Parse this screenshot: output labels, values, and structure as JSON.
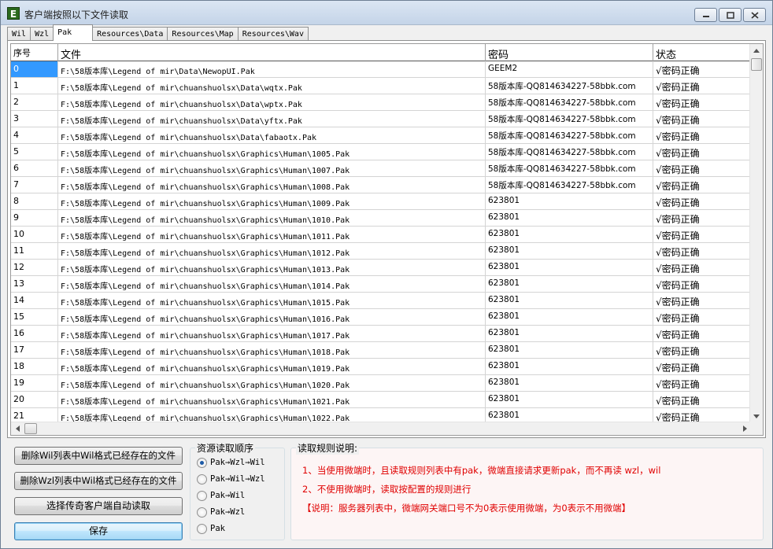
{
  "window": {
    "icon_letter": "E",
    "title": "客户端按照以下文件读取"
  },
  "tabs": [
    "Wil",
    "Wzl",
    "Pak",
    "Resources\\Data",
    "Resources\\Map",
    "Resources\\Wav"
  ],
  "active_tab": "Pak",
  "table": {
    "headers": [
      "序号",
      "文件",
      "密码",
      "状态"
    ],
    "rows": [
      [
        "0",
        "F:\\58版本库\\Legend of mir\\Data\\NewopUI.Pak",
        "GEEM2",
        "√密码正确"
      ],
      [
        "1",
        "F:\\58版本库\\Legend of mir\\chuanshuolsx\\Data\\wqtx.Pak",
        "58版本库-QQ814634227-58bbk.com",
        "√密码正确"
      ],
      [
        "2",
        "F:\\58版本库\\Legend of mir\\chuanshuolsx\\Data\\wptx.Pak",
        "58版本库-QQ814634227-58bbk.com",
        "√密码正确"
      ],
      [
        "3",
        "F:\\58版本库\\Legend of mir\\chuanshuolsx\\Data\\yftx.Pak",
        "58版本库-QQ814634227-58bbk.com",
        "√密码正确"
      ],
      [
        "4",
        "F:\\58版本库\\Legend of mir\\chuanshuolsx\\Data\\fabaotx.Pak",
        "58版本库-QQ814634227-58bbk.com",
        "√密码正确"
      ],
      [
        "5",
        "F:\\58版本库\\Legend of mir\\chuanshuolsx\\Graphics\\Human\\1005.Pak",
        "58版本库-QQ814634227-58bbk.com",
        "√密码正确"
      ],
      [
        "6",
        "F:\\58版本库\\Legend of mir\\chuanshuolsx\\Graphics\\Human\\1007.Pak",
        "58版本库-QQ814634227-58bbk.com",
        "√密码正确"
      ],
      [
        "7",
        "F:\\58版本库\\Legend of mir\\chuanshuolsx\\Graphics\\Human\\1008.Pak",
        "58版本库-QQ814634227-58bbk.com",
        "√密码正确"
      ],
      [
        "8",
        "F:\\58版本库\\Legend of mir\\chuanshuolsx\\Graphics\\Human\\1009.Pak",
        "623801",
        "√密码正确"
      ],
      [
        "9",
        "F:\\58版本库\\Legend of mir\\chuanshuolsx\\Graphics\\Human\\1010.Pak",
        "623801",
        "√密码正确"
      ],
      [
        "10",
        "F:\\58版本库\\Legend of mir\\chuanshuolsx\\Graphics\\Human\\1011.Pak",
        "623801",
        "√密码正确"
      ],
      [
        "11",
        "F:\\58版本库\\Legend of mir\\chuanshuolsx\\Graphics\\Human\\1012.Pak",
        "623801",
        "√密码正确"
      ],
      [
        "12",
        "F:\\58版本库\\Legend of mir\\chuanshuolsx\\Graphics\\Human\\1013.Pak",
        "623801",
        "√密码正确"
      ],
      [
        "13",
        "F:\\58版本库\\Legend of mir\\chuanshuolsx\\Graphics\\Human\\1014.Pak",
        "623801",
        "√密码正确"
      ],
      [
        "14",
        "F:\\58版本库\\Legend of mir\\chuanshuolsx\\Graphics\\Human\\1015.Pak",
        "623801",
        "√密码正确"
      ],
      [
        "15",
        "F:\\58版本库\\Legend of mir\\chuanshuolsx\\Graphics\\Human\\1016.Pak",
        "623801",
        "√密码正确"
      ],
      [
        "16",
        "F:\\58版本库\\Legend of mir\\chuanshuolsx\\Graphics\\Human\\1017.Pak",
        "623801",
        "√密码正确"
      ],
      [
        "17",
        "F:\\58版本库\\Legend of mir\\chuanshuolsx\\Graphics\\Human\\1018.Pak",
        "623801",
        "√密码正确"
      ],
      [
        "18",
        "F:\\58版本库\\Legend of mir\\chuanshuolsx\\Graphics\\Human\\1019.Pak",
        "623801",
        "√密码正确"
      ],
      [
        "19",
        "F:\\58版本库\\Legend of mir\\chuanshuolsx\\Graphics\\Human\\1020.Pak",
        "623801",
        "√密码正确"
      ],
      [
        "20",
        "F:\\58版本库\\Legend of mir\\chuanshuolsx\\Graphics\\Human\\1021.Pak",
        "623801",
        "√密码正确"
      ],
      [
        "21",
        "F:\\58版本库\\Legend of mir\\chuanshuolsx\\Graphics\\Human\\1022.Pak",
        "623801",
        "√密码正确"
      ]
    ],
    "selected_row": "0"
  },
  "buttons": {
    "delete_wil": "删除Wil列表中Wil格式已经存在的文件",
    "delete_wzl": "删除Wzl列表中Wil格式已经存在的文件",
    "select_client": "选择传奇客户端自动读取",
    "save": "保存"
  },
  "read_order": {
    "legend": "资源读取顺序",
    "options": [
      "Pak→Wzl→Wil",
      "Pak→Wil→Wzl",
      "Pak→Wil",
      "Pak→Wzl",
      "Pak"
    ],
    "selected": "Pak→Wzl→Wil"
  },
  "rules": {
    "legend": "读取规则说明:",
    "lines": [
      "1、当使用微端时，且读取规则列表中有pak，微端直接请求更新pak，而不再读 wzl，wil",
      "2、不使用微端时，读取按配置的规则进行",
      "【说明：服务器列表中，微端网关端口号不为0表示使用微端，为0表示不用微端】"
    ],
    "text_color": "#e00000"
  }
}
